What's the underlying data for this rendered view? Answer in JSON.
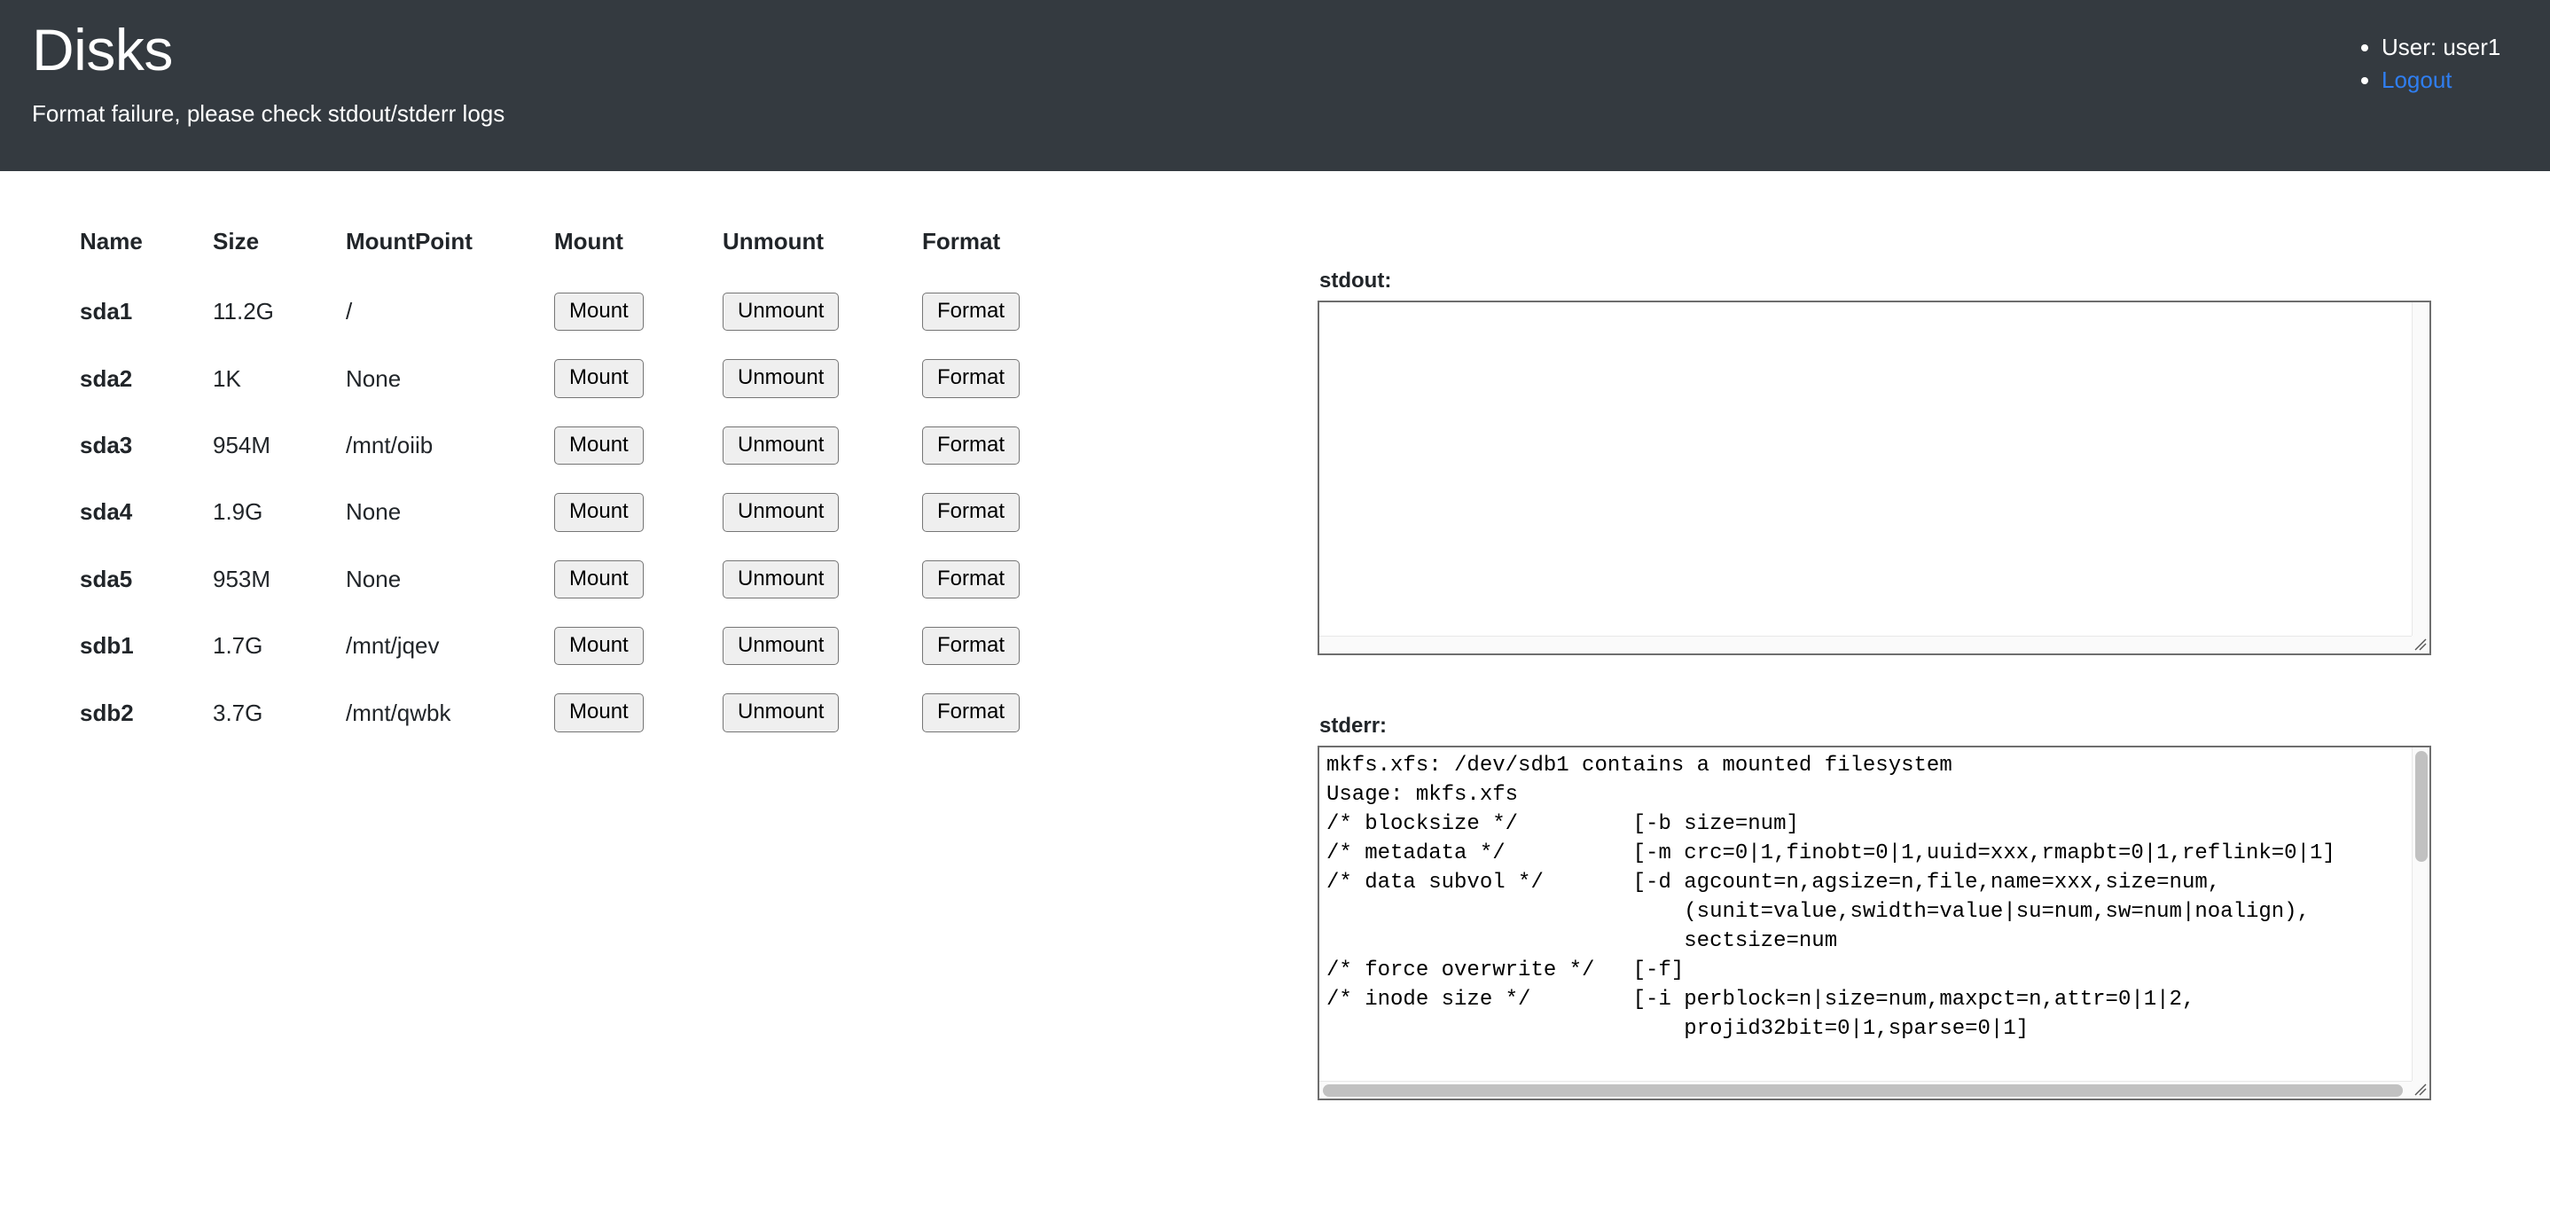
{
  "header": {
    "title": "Disks",
    "subtitle": "Format failure, please check stdout/stderr logs",
    "user_label": "User: user1",
    "logout_label": "Logout",
    "bg_color": "#343a40",
    "link_color": "#2f7ef1"
  },
  "table": {
    "columns": [
      "Name",
      "Size",
      "MountPoint",
      "Mount",
      "Unmount",
      "Format"
    ],
    "buttons": {
      "mount": "Mount",
      "unmount": "Unmount",
      "format": "Format"
    },
    "rows": [
      {
        "name": "sda1",
        "size": "11.2G",
        "mountpoint": "/"
      },
      {
        "name": "sda2",
        "size": "1K",
        "mountpoint": "None"
      },
      {
        "name": "sda3",
        "size": "954M",
        "mountpoint": "/mnt/oiib"
      },
      {
        "name": "sda4",
        "size": "1.9G",
        "mountpoint": "None"
      },
      {
        "name": "sda5",
        "size": "953M",
        "mountpoint": "None"
      },
      {
        "name": "sdb1",
        "size": "1.7G",
        "mountpoint": "/mnt/jqev"
      },
      {
        "name": "sdb2",
        "size": "3.7G",
        "mountpoint": "/mnt/qwbk"
      }
    ]
  },
  "output": {
    "stdout_label": "stdout:",
    "stdout_value": "",
    "stderr_label": "stderr:",
    "stderr_value": "mkfs.xfs: /dev/sdb1 contains a mounted filesystem\nUsage: mkfs.xfs\n/* blocksize */\t\t[-b size=num]\n/* metadata */\t\t[-m crc=0|1,finobt=0|1,uuid=xxx,rmapbt=0|1,reflink=0|1]\n/* data subvol */\t[-d agcount=n,agsize=n,file,name=xxx,size=num,\n\t\t\t    (sunit=value,swidth=value|su=num,sw=num|noalign),\n\t\t\t    sectsize=num\n/* force overwrite */\t[-f]\n/* inode size */\t[-i perblock=n|size=num,maxpct=n,attr=0|1|2,\n\t\t\t    projid32bit=0|1,sparse=0|1]"
  }
}
